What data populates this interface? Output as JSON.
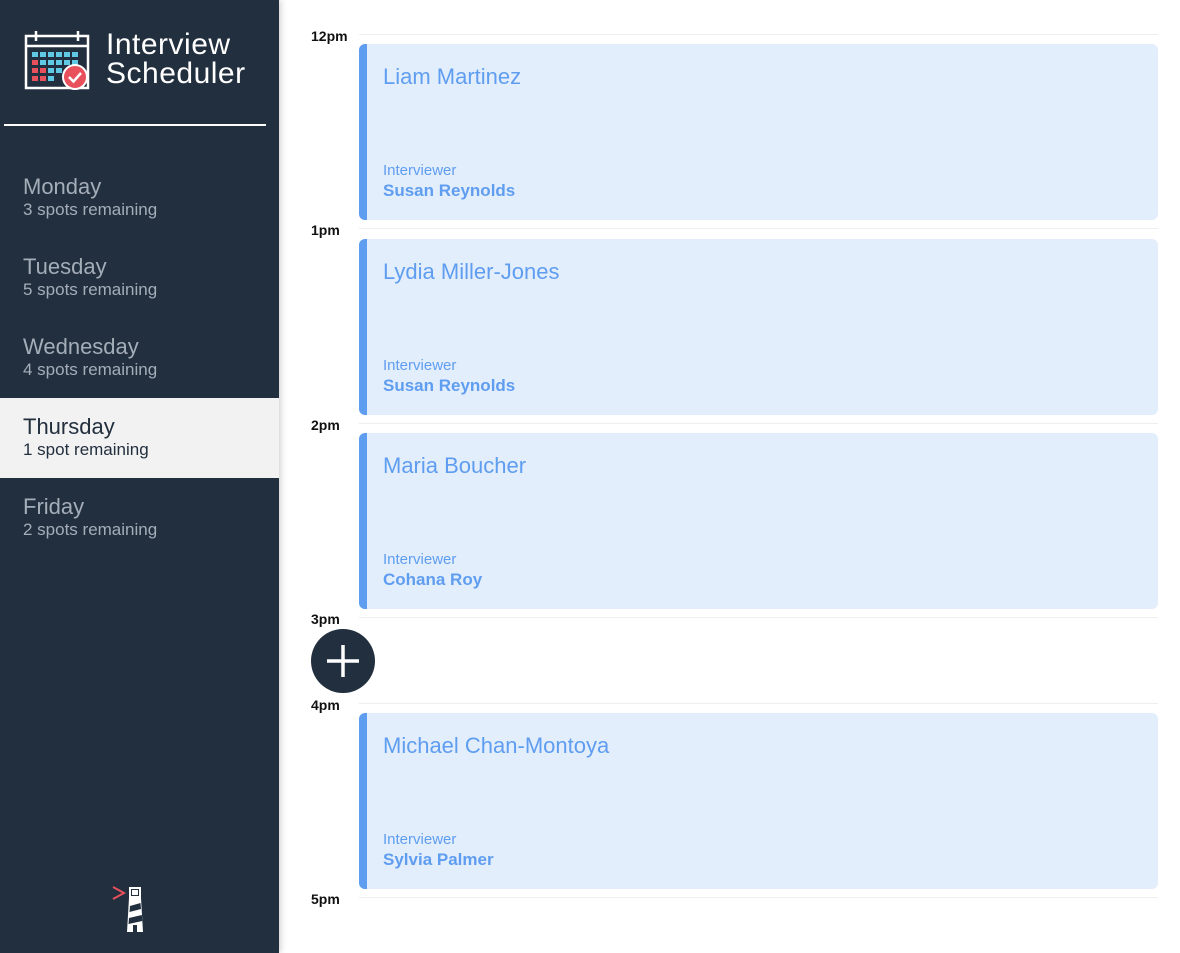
{
  "app": {
    "title_line1": "Interview",
    "title_line2": "Scheduler",
    "logo_icon": "calendar-check-icon",
    "footer_icon": "lighthouse-icon"
  },
  "days": [
    {
      "name": "Monday",
      "spots": "3 spots remaining",
      "selected": false
    },
    {
      "name": "Tuesday",
      "spots": "5 spots remaining",
      "selected": false
    },
    {
      "name": "Wednesday",
      "spots": "4 spots remaining",
      "selected": false
    },
    {
      "name": "Thursday",
      "spots": "1 spot remaining",
      "selected": true
    },
    {
      "name": "Friday",
      "spots": "2 spots remaining",
      "selected": false
    }
  ],
  "hours": [
    "12pm",
    "1pm",
    "2pm",
    "3pm",
    "4pm",
    "5pm"
  ],
  "appointments": [
    {
      "time": "12pm",
      "student": "Liam Martinez",
      "interviewer_label": "Interviewer",
      "interviewer": "Susan Reynolds"
    },
    {
      "time": "1pm",
      "student": "Lydia Miller-Jones",
      "interviewer_label": "Interviewer",
      "interviewer": "Susan Reynolds"
    },
    {
      "time": "2pm",
      "student": "Maria Boucher",
      "interviewer_label": "Interviewer",
      "interviewer": "Cohana Roy"
    },
    {
      "time": "3pm",
      "empty": true,
      "add_icon": "plus-icon"
    },
    {
      "time": "4pm",
      "student": "Michael Chan-Montoya",
      "interviewer_label": "Interviewer",
      "interviewer": "Sylvia Palmer"
    }
  ],
  "colors": {
    "sidebar": "#222f3e",
    "accent": "#5f9df0",
    "appointment_bg": "#e3eefc",
    "selected_bg": "#f2f2f2",
    "logo_red": "#e8505b",
    "logo_blue": "#5ec8e5"
  }
}
